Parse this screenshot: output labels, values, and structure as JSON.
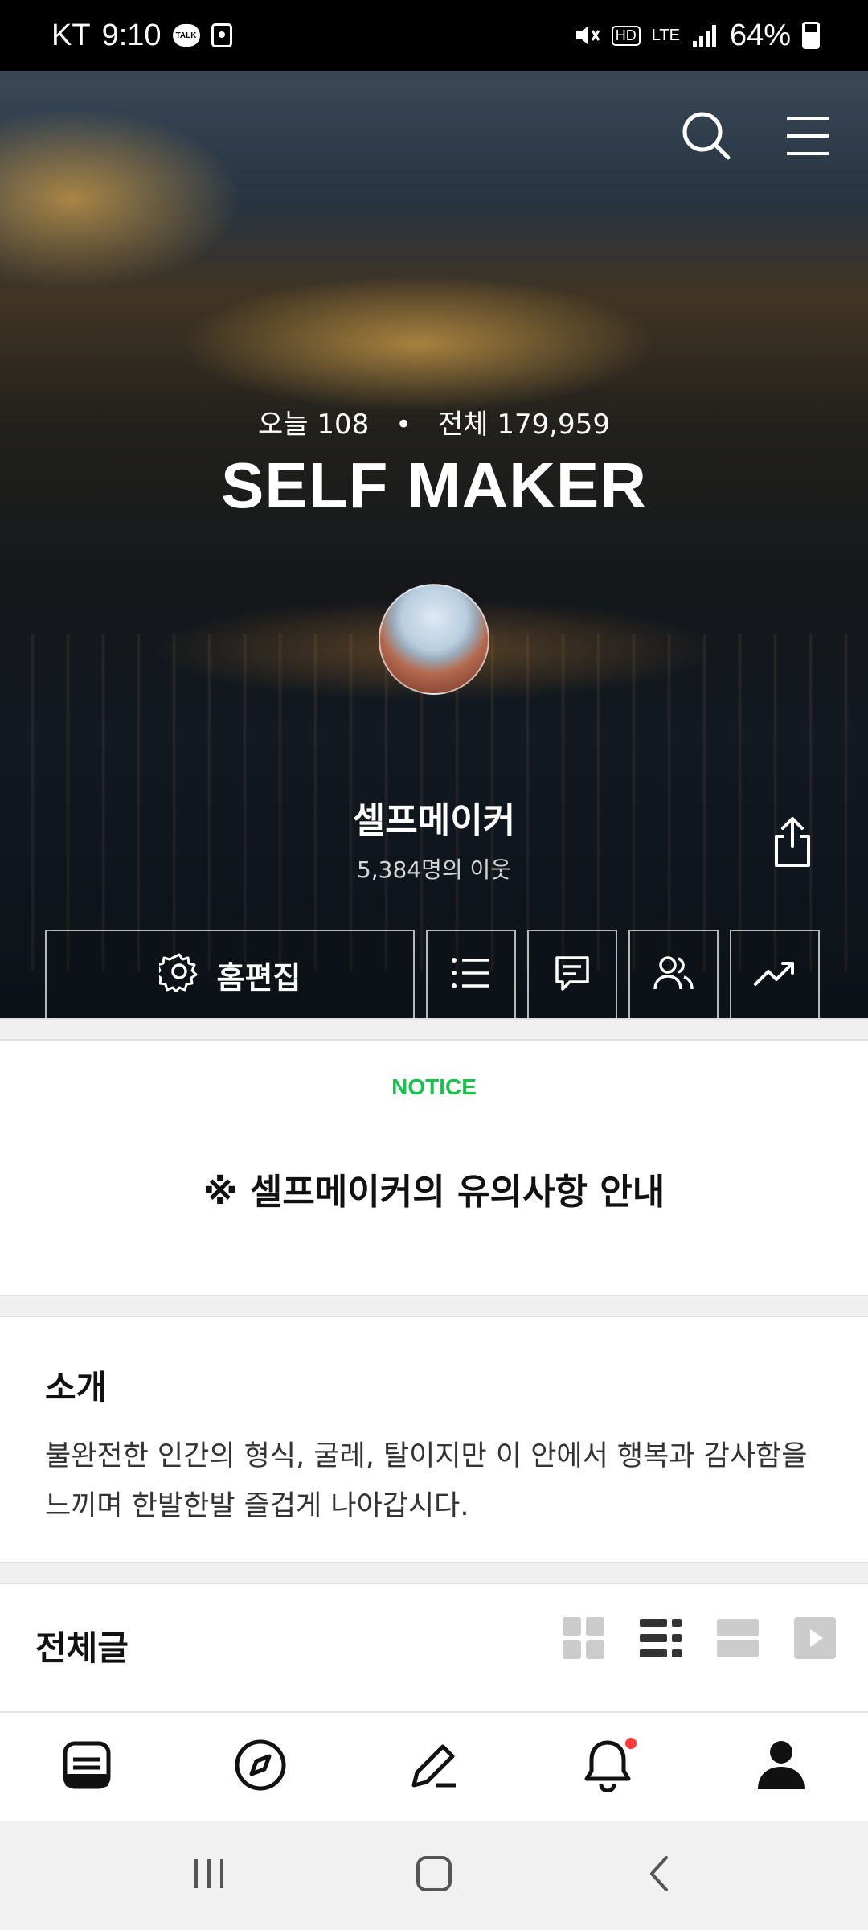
{
  "status_bar": {
    "carrier": "KT",
    "time": "9:10",
    "talk_badge": "TALK",
    "hd": "HD",
    "lte": "LTE",
    "battery": "64%"
  },
  "hero": {
    "today_label": "오늘 108",
    "total_label": "전체 179,959",
    "separator": "•",
    "blog_title": "SELF MAKER",
    "nickname": "셀프메이커",
    "neighbors": "5,384명의 이웃",
    "edit_label": "홈편집"
  },
  "notice": {
    "label": "NOTICE",
    "title": "※ 셀프메이커의 유의사항 안내"
  },
  "intro": {
    "heading": "소개",
    "body": "불완전한 인간의 형식, 굴레, 탈이지만 이 안에서 행복과 감사함을 느끼며 한발한발 즐겁게 나아갑시다."
  },
  "posts": {
    "heading": "전체글"
  },
  "icons": {
    "accent_notice": "#19c24a",
    "notification_dot": "#ff3b3b"
  }
}
